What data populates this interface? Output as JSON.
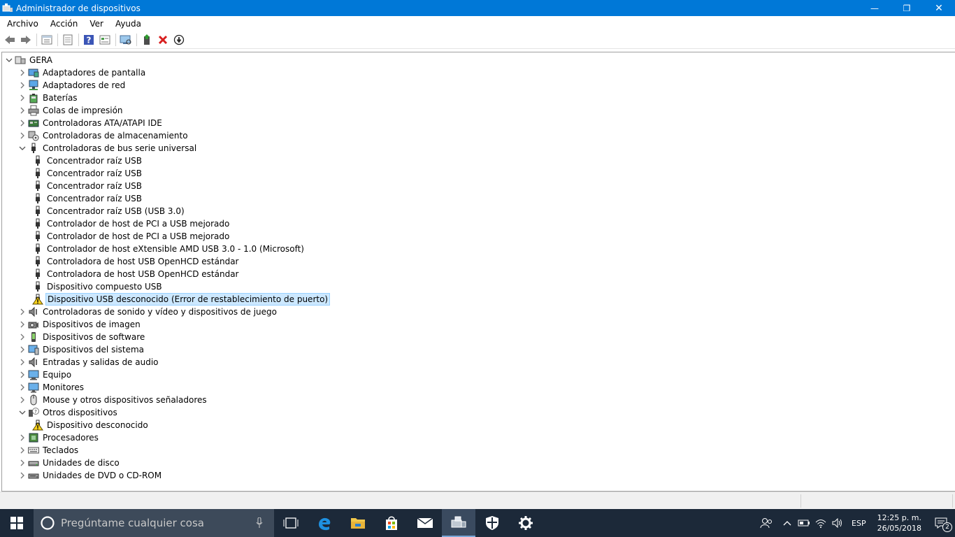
{
  "window": {
    "title": "Administrador de dispositivos",
    "controls": {
      "minimize": "—",
      "maximize": "❐",
      "close": "✕"
    }
  },
  "menu": [
    "Archivo",
    "Acción",
    "Ver",
    "Ayuda"
  ],
  "toolbar": [
    {
      "name": "back-icon"
    },
    {
      "name": "forward-icon"
    },
    {
      "name": "sep"
    },
    {
      "name": "device-view-icon"
    },
    {
      "name": "sep"
    },
    {
      "name": "properties-icon"
    },
    {
      "name": "sep"
    },
    {
      "name": "help-icon"
    },
    {
      "name": "show-hidden-icon"
    },
    {
      "name": "sep"
    },
    {
      "name": "scan-hardware-icon"
    },
    {
      "name": "sep"
    },
    {
      "name": "update-driver-icon"
    },
    {
      "name": "uninstall-icon"
    },
    {
      "name": "disable-device-icon"
    }
  ],
  "tree": {
    "root": "GERA",
    "items": [
      {
        "label": "Adaptadores de pantalla",
        "level": 1,
        "expanded": false,
        "icon": "display-adapter-icon"
      },
      {
        "label": "Adaptadores de red",
        "level": 1,
        "expanded": false,
        "icon": "network-adapter-icon"
      },
      {
        "label": "Baterías",
        "level": 1,
        "expanded": false,
        "icon": "battery-icon"
      },
      {
        "label": "Colas de impresión",
        "level": 1,
        "expanded": false,
        "icon": "printer-icon"
      },
      {
        "label": "Controladoras ATA/ATAPI IDE",
        "level": 1,
        "expanded": false,
        "icon": "ide-controller-icon"
      },
      {
        "label": "Controladoras de almacenamiento",
        "level": 1,
        "expanded": false,
        "icon": "storage-controller-icon"
      },
      {
        "label": "Controladoras de bus serie universal",
        "level": 1,
        "expanded": true,
        "icon": "usb-icon"
      },
      {
        "label": "Concentrador raíz USB",
        "level": 2,
        "icon": "usb-icon"
      },
      {
        "label": "Concentrador raíz USB",
        "level": 2,
        "icon": "usb-icon"
      },
      {
        "label": "Concentrador raíz USB",
        "level": 2,
        "icon": "usb-icon"
      },
      {
        "label": "Concentrador raíz USB",
        "level": 2,
        "icon": "usb-icon"
      },
      {
        "label": "Concentrador raíz USB (USB 3.0)",
        "level": 2,
        "icon": "usb-icon"
      },
      {
        "label": "Controlador de host de PCI a USB mejorado",
        "level": 2,
        "icon": "usb-icon"
      },
      {
        "label": "Controlador de host de PCI a USB mejorado",
        "level": 2,
        "icon": "usb-icon"
      },
      {
        "label": "Controlador de host eXtensible AMD USB 3.0 - 1.0 (Microsoft)",
        "level": 2,
        "icon": "usb-icon"
      },
      {
        "label": "Controladora de host USB OpenHCD estándar",
        "level": 2,
        "icon": "usb-icon"
      },
      {
        "label": "Controladora de host USB OpenHCD estándar",
        "level": 2,
        "icon": "usb-icon"
      },
      {
        "label": "Dispositivo compuesto USB",
        "level": 2,
        "icon": "usb-icon"
      },
      {
        "label": "Dispositivo USB desconocido (Error de restablecimiento de puerto)",
        "level": 2,
        "icon": "warning-icon",
        "selected": true
      },
      {
        "label": "Controladoras de sonido y vídeo y dispositivos de juego",
        "level": 1,
        "expanded": false,
        "icon": "speaker-icon"
      },
      {
        "label": "Dispositivos de imagen",
        "level": 1,
        "expanded": false,
        "icon": "camera-icon"
      },
      {
        "label": "Dispositivos de software",
        "level": 1,
        "expanded": false,
        "icon": "software-device-icon"
      },
      {
        "label": "Dispositivos del sistema",
        "level": 1,
        "expanded": false,
        "icon": "system-device-icon"
      },
      {
        "label": "Entradas y salidas de audio",
        "level": 1,
        "expanded": false,
        "icon": "speaker-icon"
      },
      {
        "label": "Equipo",
        "level": 1,
        "expanded": false,
        "icon": "computer-icon"
      },
      {
        "label": "Monitores",
        "level": 1,
        "expanded": false,
        "icon": "monitor-icon"
      },
      {
        "label": "Mouse y otros dispositivos señaladores",
        "level": 1,
        "expanded": false,
        "icon": "mouse-icon"
      },
      {
        "label": "Otros dispositivos",
        "level": 1,
        "expanded": true,
        "icon": "unknown-device-icon"
      },
      {
        "label": "Dispositivo desconocido",
        "level": 2,
        "icon": "warning-icon"
      },
      {
        "label": "Procesadores",
        "level": 1,
        "expanded": false,
        "icon": "processor-icon"
      },
      {
        "label": "Teclados",
        "level": 1,
        "expanded": false,
        "icon": "keyboard-icon"
      },
      {
        "label": "Unidades de disco",
        "level": 1,
        "expanded": false,
        "icon": "disk-drive-icon"
      },
      {
        "label": "Unidades de DVD o CD-ROM",
        "level": 1,
        "expanded": false,
        "icon": "dvd-drive-icon"
      }
    ]
  },
  "taskbar": {
    "search_placeholder": "Pregúntame cualquier cosa",
    "apps": [
      "task-view-icon",
      "edge-icon",
      "file-explorer-icon",
      "store-icon",
      "mail-icon",
      "device-manager-icon",
      "security-icon",
      "settings-icon"
    ],
    "active_app": "device-manager-icon",
    "language": "ESP",
    "time": "12:25 p. m.",
    "date": "26/05/2018",
    "notification_count": "2"
  }
}
